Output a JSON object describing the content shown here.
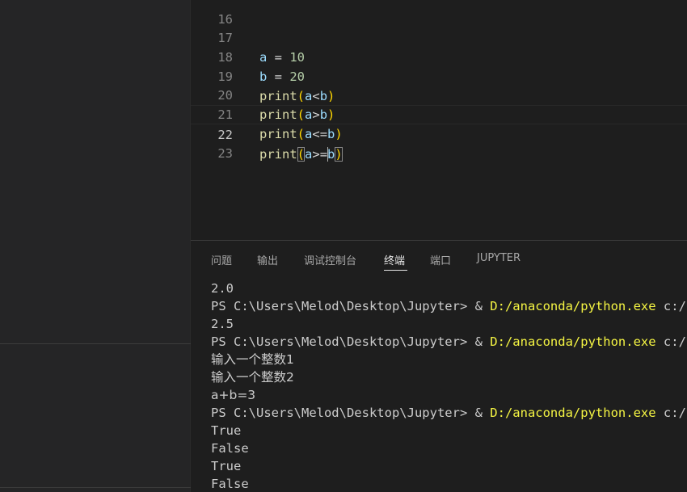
{
  "editor": {
    "lines": [
      {
        "num": "16",
        "code": ""
      },
      {
        "num": "17",
        "code": "a = 10"
      },
      {
        "num": "18",
        "code": "b = 20"
      },
      {
        "num": "19",
        "code": "print(a<b)"
      },
      {
        "num": "20",
        "code": "print(a>b)"
      },
      {
        "num": "21",
        "code": "print(a<=b)"
      },
      {
        "num": "22",
        "code": "print(a>=b)"
      },
      {
        "num": "23",
        "code": ""
      }
    ],
    "current_line": "22"
  },
  "panel": {
    "tabs": [
      {
        "label": "问题"
      },
      {
        "label": "输出"
      },
      {
        "label": "调试控制台"
      },
      {
        "label": "终端"
      },
      {
        "label": "端口"
      },
      {
        "label": "JUPYTER"
      }
    ],
    "active_tab": "终端"
  },
  "terminal": {
    "prompt": "PS C:\\Users\\Melod\\Desktop\\Jupyter> & ",
    "exe": "D:/anaconda/python.exe",
    "arg": " c:/Use",
    "out1": "2.0",
    "out2": "2.5",
    "out3": "输入一个整数1",
    "out4": "输入一个整数2",
    "out5": "a+b=3",
    "out6": "True",
    "out7": "False",
    "out8": "True",
    "out9": "False"
  },
  "colors": {
    "background": "#1e1e1e",
    "sidebar": "#252526",
    "keyword_fn": "#dcdcaa",
    "variable": "#9cdcfe",
    "number": "#b5cea8",
    "bracket": "#ffd700",
    "terminal_path": "#f5f543"
  }
}
